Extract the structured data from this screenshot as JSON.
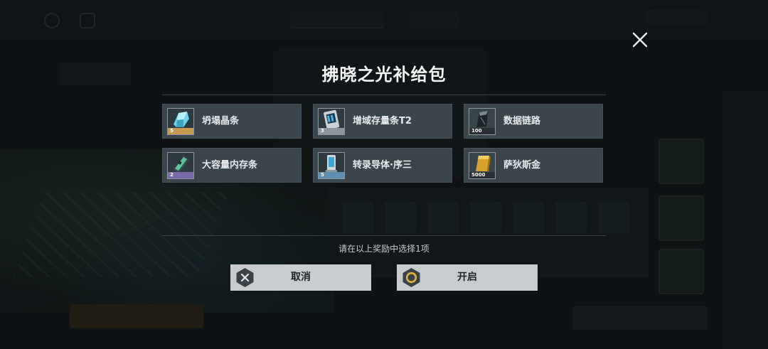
{
  "modal": {
    "title": "拂晓之光补给包",
    "hint": "请在以上奖励中选择1项",
    "items": [
      {
        "name": "坍塌晶条",
        "quantity": "5",
        "rarity_color": "#c79a52",
        "icon": "crystal-shard-icon"
      },
      {
        "name": "增域存量条T2",
        "quantity": "3",
        "rarity_color": "#8c96a0",
        "icon": "memory-card-icon"
      },
      {
        "name": "数据链路",
        "quantity": "100",
        "rarity_color": "#2a2f33",
        "icon": "data-link-icon"
      },
      {
        "name": "大容量内存条",
        "quantity": "2",
        "rarity_color": "#7a6aa8",
        "icon": "memory-stick-icon"
      },
      {
        "name": "转录导体·序三",
        "quantity": "5",
        "rarity_color": "#5f8fb0",
        "icon": "conductor-icon"
      },
      {
        "name": "萨狄斯金",
        "quantity": "5000",
        "rarity_color": "#2a2f33",
        "icon": "gold-bar-icon"
      }
    ],
    "buttons": {
      "cancel_label": "取消",
      "open_label": "开启"
    },
    "colors": {
      "panel_item": "#3a464c",
      "button_bg": "#c9ccce",
      "confirm_accent": "#e2b33a"
    }
  }
}
